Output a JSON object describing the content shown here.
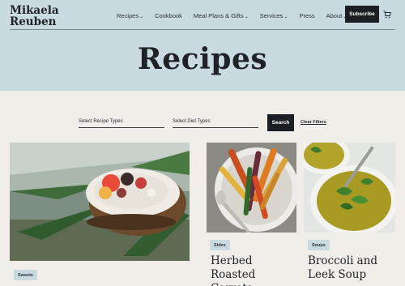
{
  "brand": {
    "line1": "Mikaela",
    "line2": "Reuben"
  },
  "nav": [
    {
      "label": "Recipes",
      "has_chevron": true
    },
    {
      "label": "Cookbook",
      "has_chevron": false
    },
    {
      "label": "Meal Plans & Gifts",
      "has_chevron": true
    },
    {
      "label": "Services",
      "has_chevron": true
    },
    {
      "label": "Press",
      "has_chevron": false
    },
    {
      "label": "About",
      "has_chevron": true
    }
  ],
  "chevron_glyph": "⌄",
  "subscribe_label": "Subscribe",
  "cart_icon": "cart-icon",
  "page_title": "Recipes",
  "filters": {
    "recipe_types": "Select Recipe Types",
    "diet_types": "Select Diet Types",
    "search_label": "Search",
    "clear_label": "Clear Filters"
  },
  "cards": [
    {
      "tag": "Sweets",
      "title": "",
      "image": "coconut bowl with strawberries"
    },
    {
      "tag": "Sides",
      "title": "Herbed Roasted Carrots",
      "image": "roasted carrots on plate"
    },
    {
      "tag": "Soups",
      "title": "Broccoli and Leek Soup",
      "image": "green soup bowls"
    }
  ],
  "colors": {
    "hero": "#c9dbe0",
    "background": "#f1ede9",
    "button": "#1b1e22"
  }
}
